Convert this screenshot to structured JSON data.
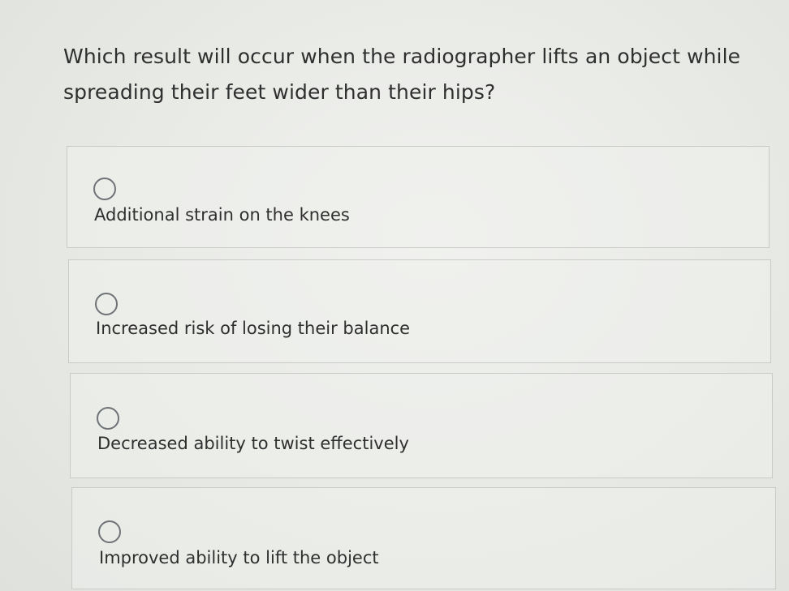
{
  "question": {
    "text": "Which result will occur when the radiographer lifts an object while spreading their feet wider than their hips?"
  },
  "options": [
    {
      "label": "Additional strain on the knees",
      "icon": "radio-unselected-icon",
      "selected": false
    },
    {
      "label": "Increased risk of losing their balance",
      "icon": "radio-unselected-icon",
      "selected": false
    },
    {
      "label": "Decreased ability to twist effectively",
      "icon": "radio-unselected-icon",
      "selected": false
    },
    {
      "label": "Improved ability to lift the object",
      "icon": "radio-unselected-icon",
      "selected": false
    }
  ]
}
